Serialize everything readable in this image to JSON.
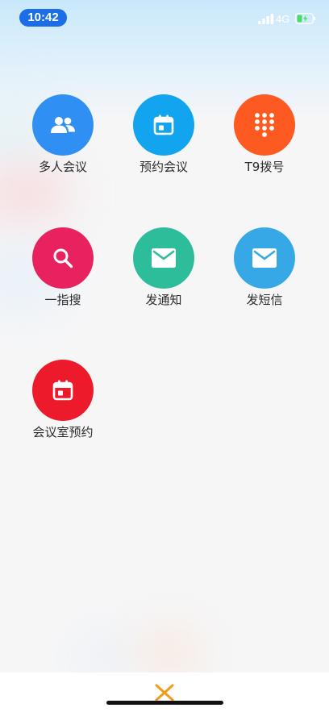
{
  "status_bar": {
    "time": "10:42",
    "network": "4G"
  },
  "grid": [
    {
      "label": "多人会议",
      "icon": "people-icon",
      "color": "#2f8ff2"
    },
    {
      "label": "预约会议",
      "icon": "calendar-icon",
      "color": "#12a4ef"
    },
    {
      "label": "T9拨号",
      "icon": "dialpad-icon",
      "color": "#fd5a22"
    },
    {
      "label": "一指搜",
      "icon": "search-icon",
      "color": "#e8225f"
    },
    {
      "label": "发通知",
      "icon": "mail-icon",
      "color": "#2ebd9b"
    },
    {
      "label": "发短信",
      "icon": "mail-icon",
      "color": "#35a8e5"
    },
    {
      "label": "会议室预约",
      "icon": "calendar-icon",
      "color": "#ec1a2a"
    }
  ],
  "close": {
    "icon": "close-icon",
    "color": "#f59a1a"
  }
}
